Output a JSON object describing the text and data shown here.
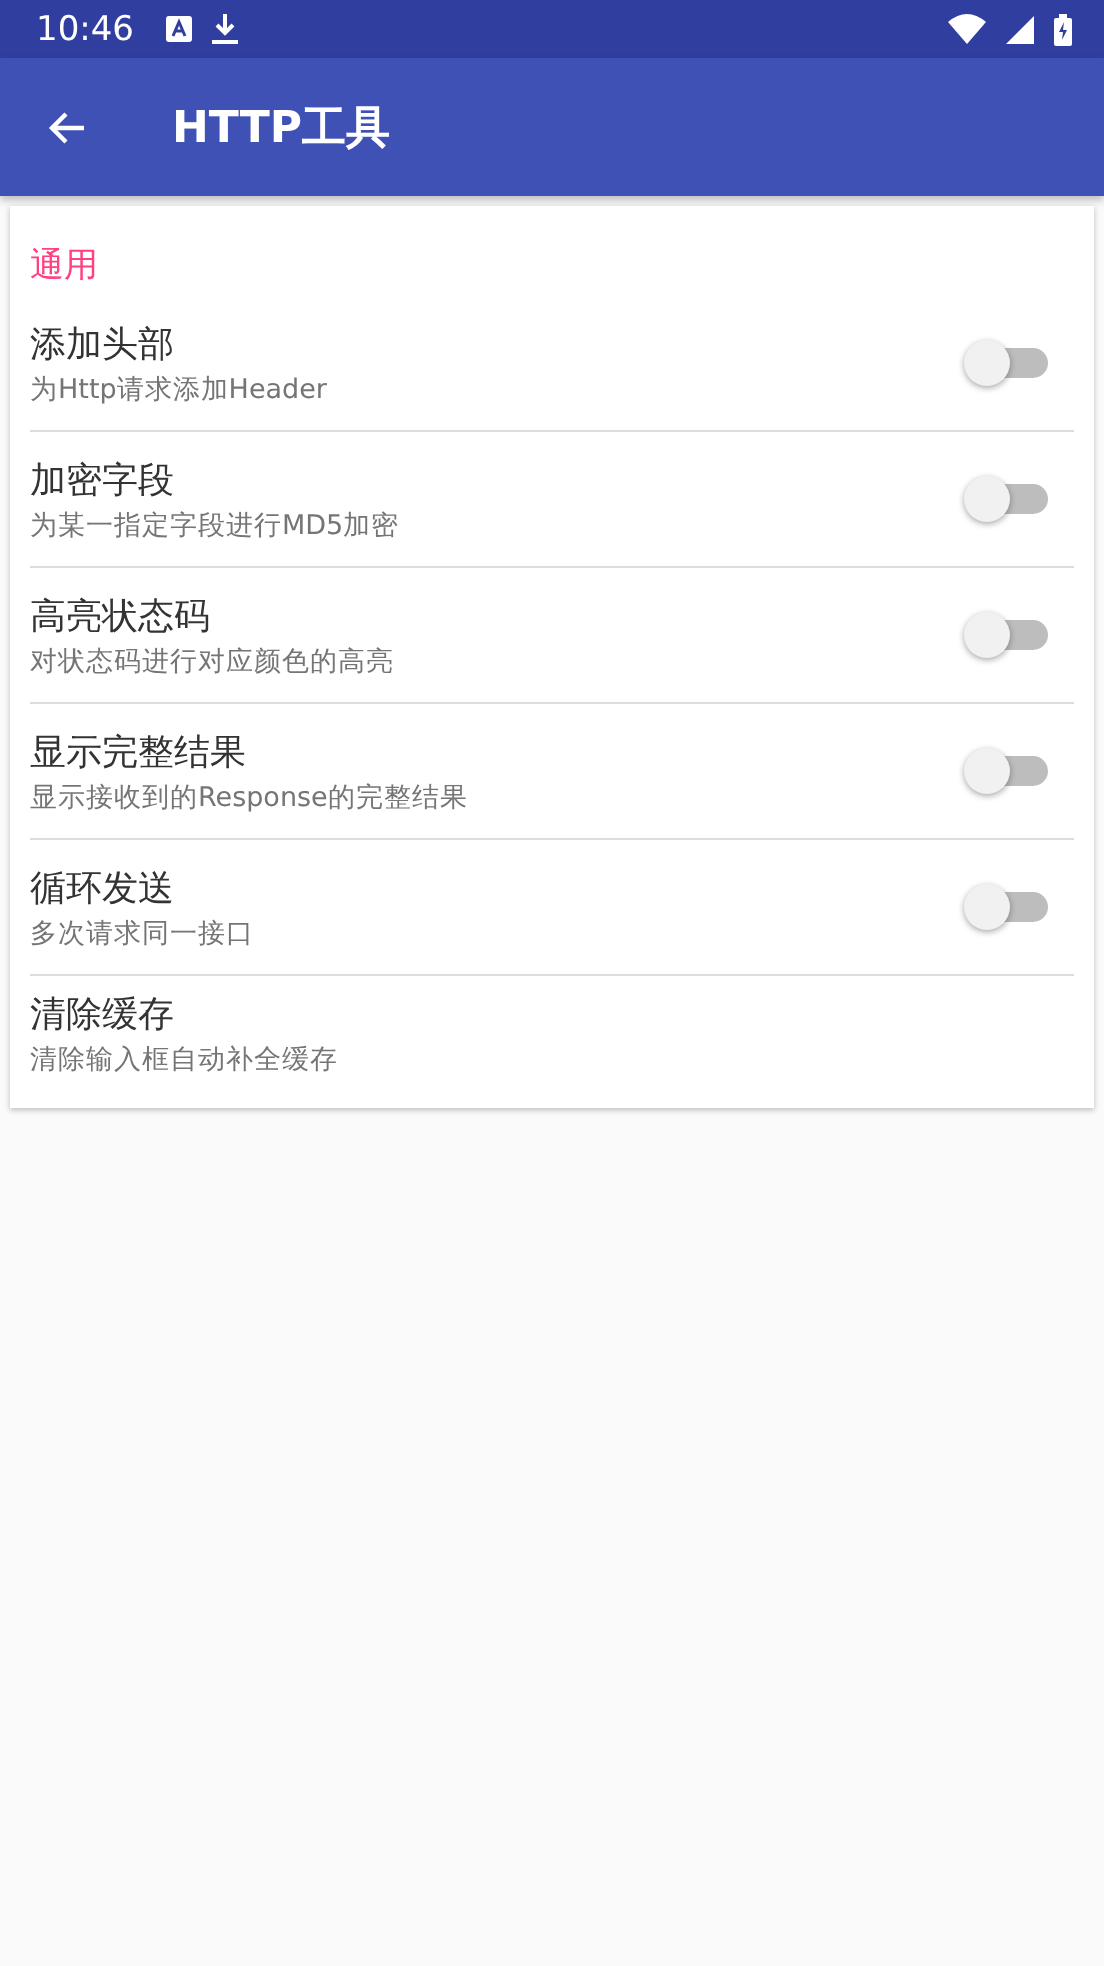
{
  "status_bar": {
    "time": "10:46"
  },
  "toolbar": {
    "title": "HTTP工具"
  },
  "section": {
    "title": "通用"
  },
  "items": [
    {
      "kind": "switch",
      "title": "添加头部",
      "summary": "为Http请求添加Header",
      "on": false
    },
    {
      "kind": "switch",
      "title": "加密字段",
      "summary": "为某一指定字段进行MD5加密",
      "on": false
    },
    {
      "kind": "switch",
      "title": "高亮状态码",
      "summary": "对状态码进行对应颜色的高亮",
      "on": false
    },
    {
      "kind": "switch",
      "title": "显示完整结果",
      "summary": "显示接收到的Response的完整结果",
      "on": false
    },
    {
      "kind": "switch",
      "title": "循环发送",
      "summary": "多次请求同一接口",
      "on": false
    },
    {
      "kind": "action",
      "title": "清除缓存",
      "summary": "清除输入框自动补全缓存"
    }
  ]
}
